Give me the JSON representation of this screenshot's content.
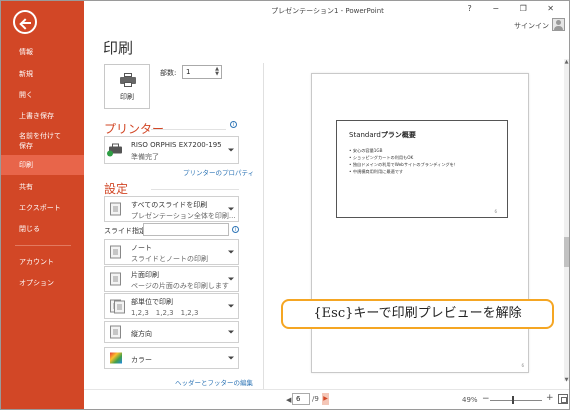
{
  "window": {
    "title": "プレゼンテーション1 - PowerPoint",
    "controls": "? − ❐ ✕",
    "signin": "サインイン"
  },
  "sidebar": {
    "items": [
      {
        "label": "情報"
      },
      {
        "label": "新規"
      },
      {
        "label": "開く"
      },
      {
        "label": "上書き保存"
      },
      {
        "label": "名前を付けて\n保存"
      },
      {
        "label": "印刷"
      },
      {
        "label": "共有"
      },
      {
        "label": "エクスポート"
      },
      {
        "label": "閉じる"
      },
      {
        "label": "アカウント"
      },
      {
        "label": "オプション"
      }
    ],
    "active": "印刷",
    "accent": "#d24726"
  },
  "print": {
    "heading": "印刷",
    "button_label": "印刷",
    "copies_label": "部数:",
    "copies_value": "1"
  },
  "printer": {
    "heading": "プリンター",
    "name": "RISO ORPHIS EX7200-195",
    "status": "準備完了",
    "properties_link": "プリンターのプロパティ"
  },
  "settings": {
    "heading": "設定",
    "slides_label": "スライド指定:",
    "footer_link": "ヘッダーとフッターの編集",
    "options": [
      {
        "line1": "すべてのスライドを印刷",
        "line2": "プレゼンテーション全体を印刷..."
      },
      {
        "line1": "ノート",
        "line2": "スライドとノートの印刷"
      },
      {
        "line1": "片面印刷",
        "line2": "ページの片面のみを印刷します"
      },
      {
        "line1": "部単位で印刷",
        "line2": "1,2,3　1,2,3　1,2,3"
      },
      {
        "line1": "縦方向",
        "line2": ""
      },
      {
        "line1": "カラー",
        "line2": ""
      }
    ]
  },
  "preview": {
    "slide_title_plain": "Standard",
    "slide_title_bold": "プラン概要",
    "bullets": [
      "安心の容量1GB",
      "ショッピングカートの利用もOK",
      "独自ドメインの利用でWebサイトのブランディングを！",
      "中規模商用利用に最適です"
    ],
    "slide_number": "6",
    "page_number": "6"
  },
  "callout": {
    "text": "{Esc}キーで印刷プレビューを解除"
  },
  "status": {
    "current_page": "6",
    "total_pages": "/9",
    "zoom": "49%"
  }
}
